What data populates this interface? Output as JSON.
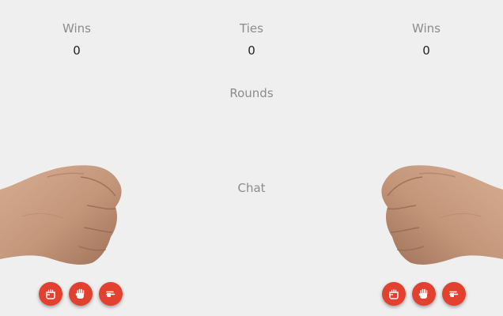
{
  "scoreboard": {
    "left": {
      "label": "Wins",
      "value": "0"
    },
    "ties": {
      "label": "Ties",
      "value": "0"
    },
    "right": {
      "label": "Wins",
      "value": "0"
    }
  },
  "rounds_label": "Rounds",
  "chat_label": "Chat",
  "players": {
    "left": {
      "hand_image": "fist-left",
      "controls": [
        "rock-icon",
        "paper-icon",
        "scissors-icon"
      ]
    },
    "right": {
      "hand_image": "fist-right",
      "controls": [
        "rock-icon",
        "paper-icon",
        "scissors-icon"
      ]
    }
  },
  "colors": {
    "background": "#efefef",
    "button": "#e2412f",
    "label": "#8c8c8c",
    "score": "#222222",
    "skin": "#c99e82"
  }
}
